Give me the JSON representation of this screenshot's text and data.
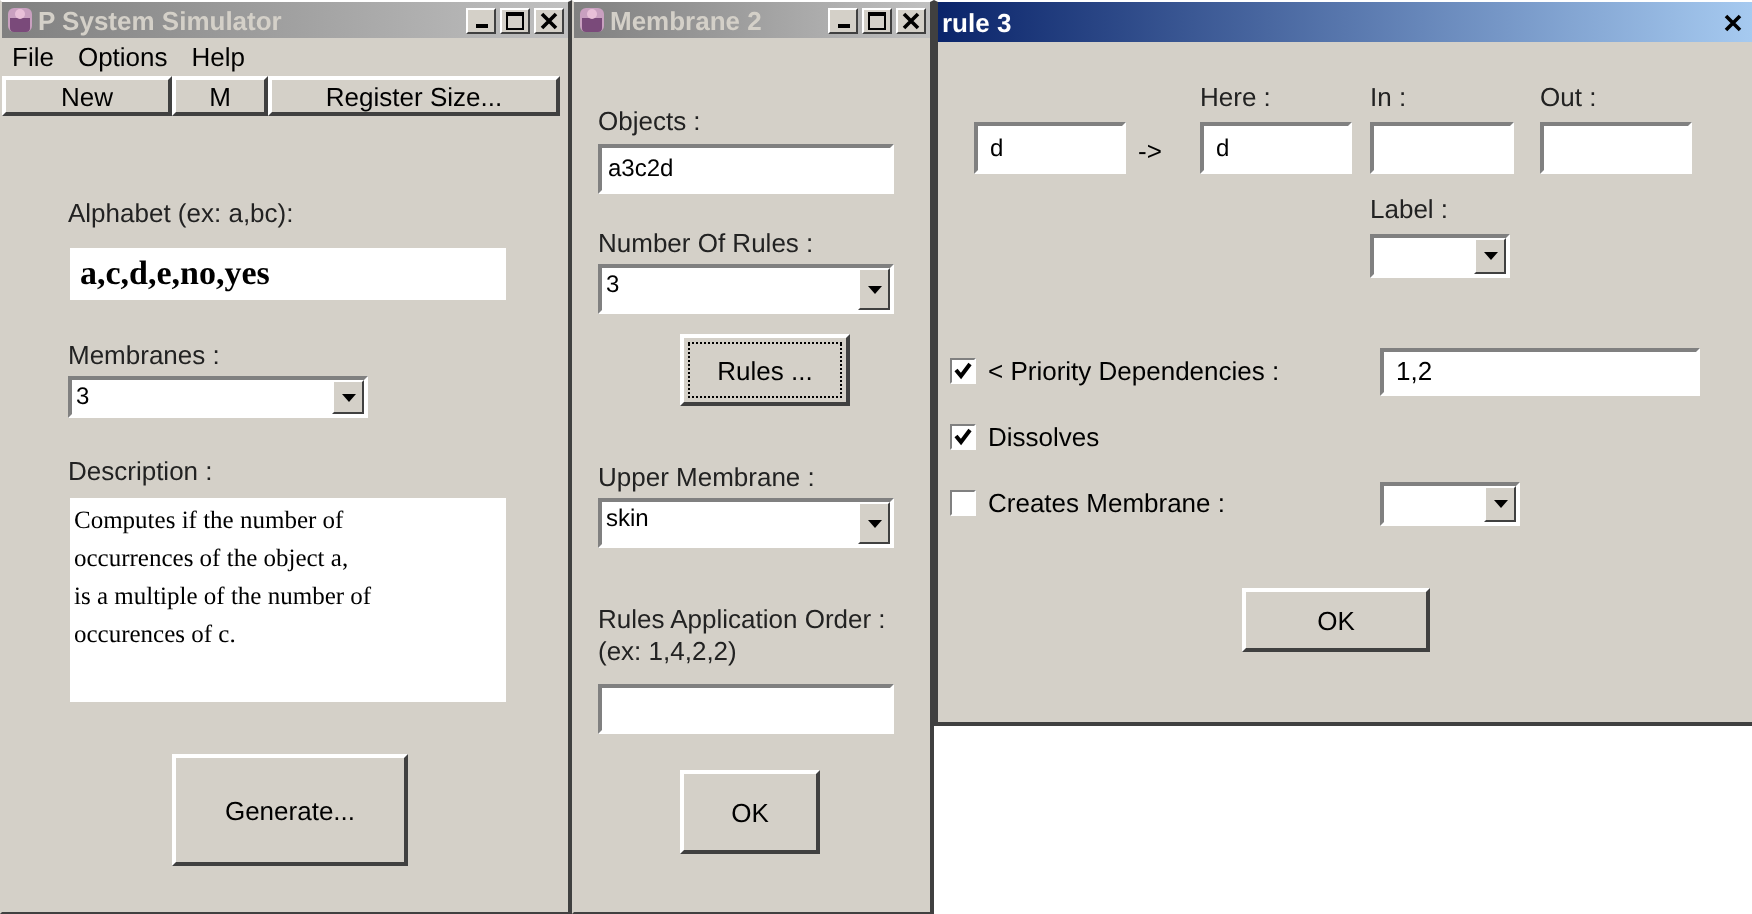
{
  "main_window": {
    "title": "P System Simulator",
    "active": false,
    "menu": [
      "File",
      "Options",
      "Help"
    ],
    "toolbar": [
      "New",
      "M",
      "Register Size..."
    ],
    "alphabet": {
      "label": "Alphabet (ex: a,bc):",
      "value": "a,c,d,e,no,yes"
    },
    "membranes": {
      "label": "Membranes :",
      "value": "3"
    },
    "description": {
      "label": "Description :",
      "value": "Computes if the number of\noccurrences of the object a,\nis a multiple of the number of\noccurences of c."
    },
    "generate_button": "Generate..."
  },
  "membrane_window": {
    "title": "Membrane 2",
    "active": false,
    "objects": {
      "label": "Objects :",
      "value": "a3c2d"
    },
    "number_of_rules": {
      "label": "Number Of Rules :",
      "value": "3"
    },
    "rules_button": {
      "label": "Rules ...",
      "focused": true
    },
    "upper_membrane": {
      "label": "Upper Membrane :",
      "value": "skin"
    },
    "application_order": {
      "label": "Rules Application Order :",
      "hint": "(ex: 1,4,2,2)"
    },
    "ok_button": "OK"
  },
  "rule_window": {
    "title": "rule 3",
    "active": true,
    "left_side": {
      "value": "d"
    },
    "arrow": "->",
    "here": {
      "label": "Here :",
      "value": "d"
    },
    "in": {
      "label": "In :"
    },
    "out": {
      "label": "Out :"
    },
    "membrane_label": {
      "label": "Label :"
    },
    "priority": {
      "label": "<  Priority Dependencies :",
      "checked": true,
      "value": "1,2"
    },
    "dissolves": {
      "label": "Dissolves",
      "checked": true
    },
    "creates_membrane": {
      "label": "Creates Membrane :",
      "checked": false
    },
    "ok_button": "OK"
  }
}
